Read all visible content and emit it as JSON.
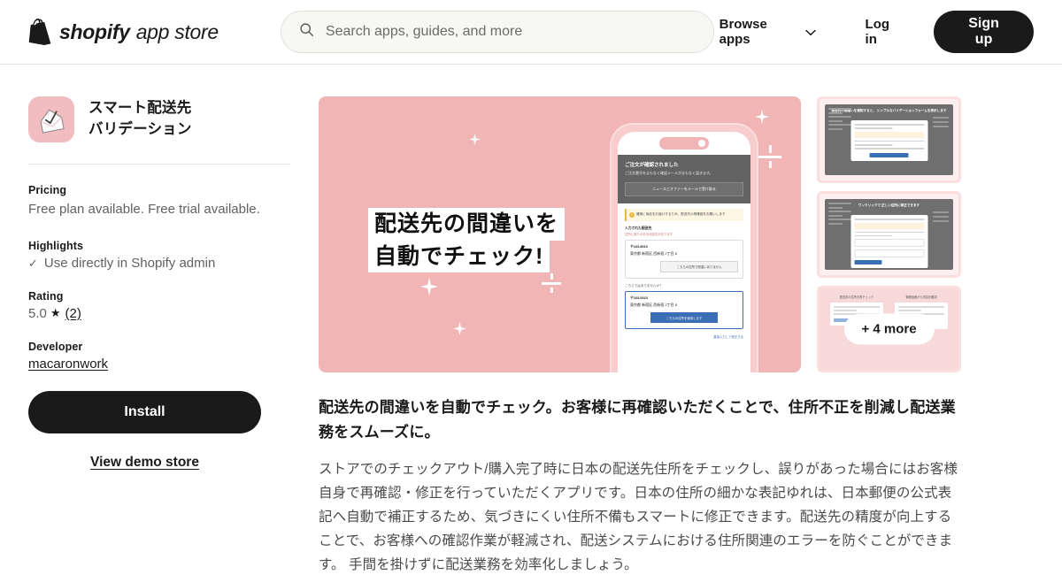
{
  "header": {
    "logo_brand": "shopify",
    "logo_suffix": "app store",
    "logo_icon": "shopify-bag-icon",
    "search": {
      "placeholder": "Search apps, guides, and more",
      "value": "",
      "icon": "search-icon"
    },
    "browse_apps": "Browse apps",
    "browse_icon": "chevron-down-icon",
    "log_in": "Log in",
    "sign_up": "Sign up"
  },
  "sidebar": {
    "app_icon": "pink-house-check-icon",
    "app_title_line1": "スマート配送先",
    "app_title_line2": "バリデーション",
    "pricing_label": "Pricing",
    "pricing_value": "Free plan available. Free trial available.",
    "highlights_label": "Highlights",
    "highlight_check_icon": "check-icon",
    "highlight_item": "Use directly in Shopify admin",
    "rating_label": "Rating",
    "rating_value": "5.0",
    "rating_star_icon": "star-icon",
    "rating_count": "(2)",
    "developer_label": "Developer",
    "developer_name": "macaronwork",
    "install_button": "Install",
    "demo_link": "View demo store"
  },
  "hero": {
    "line1": "配送先の間違いを",
    "line2": "自動でチェック!",
    "phone": {
      "header_title": "ご注文が確認されました",
      "header_sub": "ご注文番号をまもなく確認メールがまもなく届きます。",
      "header_button": "ニュースとオファーをメールで受け取る",
      "warning": "確実に商品をお届けするため、配送先の再確認をお願いします",
      "entered_label": "入力された配送先",
      "entered_sub": "住所に誤りがある可能性があります",
      "card1_zip": "〒163-8010",
      "card1_addr": "東京都 新宿区 西新宿 2丁目 8",
      "card1_button": "こちらの住所で間違いありません",
      "question": "こちらではありませんか？",
      "card2_zip": "〒163-0023",
      "card2_addr": "東京都 新宿区 西新宿 2丁目 8",
      "card2_button": "こちらの住所を使用します",
      "footer_link": "直接入力して修正する"
    }
  },
  "thumbnails": [
    {
      "name": "thumbnail-1",
      "caption": "配送先の間違いを検知すると、\nシンプルなバリデーションフォームを表示します"
    },
    {
      "name": "thumbnail-2",
      "caption": "ワンクリックで\n正しい住所に修正できます"
    },
    {
      "name": "thumbnail-3",
      "more_label": "+ 4 more",
      "caption_left": "配送前の住所を再チェック",
      "caption_right": "管理画面から内容を確認"
    }
  ],
  "description": {
    "headline": "配送先の間違いを自動でチェック。お客様に再確認いただくことで、住所不正を削減し配送業務をスムーズに。",
    "paragraph": "ストアでのチェックアウト/購入完了時に日本の配送先住所をチェックし、誤りがあった場合にはお客様自身で再確認・修正を行っていただくアプリです。日本の住所の細かな表記ゆれは、日本郵便の公式表記へ自動で補正するため、気づきにくい住所不備もスマートに修正できます。配送先の精度が向上することで、お客様への確認作業が軽減され、配送システムにおける住所関連のエラーを防ぐことができます。 手間を掛けずに配送業務を効率化しましょう。"
  },
  "colors": {
    "accent_pink": "#f2b5b5",
    "icon_pink": "#f2bcc0",
    "dark": "#1a1a1a",
    "blue": "#3a6fb5"
  }
}
